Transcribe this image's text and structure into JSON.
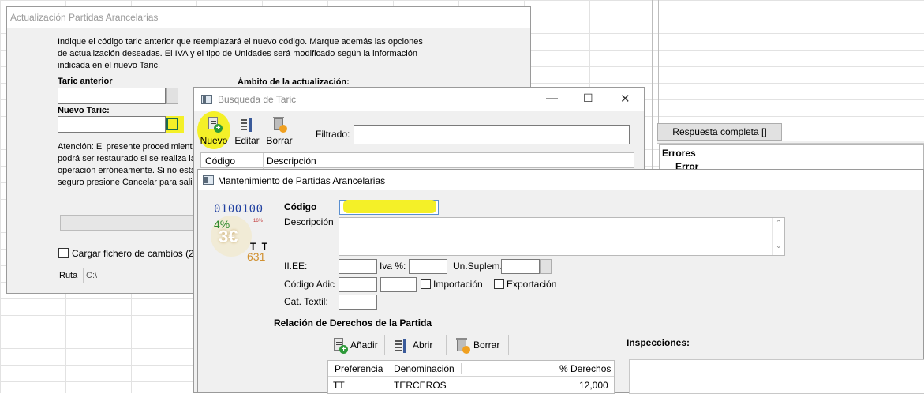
{
  "background": {
    "respuesta_button": "Respuesta completa []",
    "tree": {
      "node1": "Errores",
      "node2": "Error"
    }
  },
  "actualizacion": {
    "title": "Actualización Partidas Arancelarias",
    "description": "Indique el código taric anterior que reemplazará el nuevo código. Marque además las opciones de actualización deseadas. El IVA y el tipo de Unidades será modificado según la información indicada en el nuevo Taric.",
    "taric_anterior_label": "Taric anterior",
    "nuevo_taric_label": "Nuevo Taric:",
    "ambito_label": "Ámbito de la actualización:",
    "warning_lines": [
      "Atención: El presente procedimiento",
      "podrá ser restaurado si se realiza la",
      "operación erróneamente. Si no está",
      "seguro presione Cancelar para salir"
    ],
    "cargar_label": "Cargar fichero de cambios (2",
    "ruta_label": "Ruta",
    "ruta_value": "C:\\"
  },
  "busqueda": {
    "title": "Busqueda  de Taric",
    "controls": {
      "minimize": "—",
      "maximize": "☐",
      "close": "✕"
    },
    "toolbar": {
      "nuevo": "Nuevo",
      "editar": "Editar",
      "borrar": "Borrar"
    },
    "filtrado_label": "Filtrado:",
    "grid_headers": [
      "Código",
      "Descripción"
    ]
  },
  "mantenimiento": {
    "title": "Mantenimiento de Partidas Arancelarias",
    "logo": {
      "binary": "0100100",
      "percent": "4%",
      "euro": "3€",
      "tt": "T T",
      "number": "631",
      "small": "16%"
    },
    "fields": {
      "codigo": "Código",
      "descripcion": "Descripción",
      "iiee": "II.EE:",
      "iva": "Iva %:",
      "unsuplem": "Un.Suplem.",
      "codigo_adic": "Código Adic",
      "importacion": "Importación",
      "exportacion": "Exportación",
      "cat_textil": "Cat. Textil:"
    },
    "relacion_label": "Relación de Derechos de la Partida",
    "inspecciones_label": "Inspecciones:",
    "toolbar": {
      "anadir": "Añadir",
      "abrir": "Abrir",
      "borrar": "Borrar"
    },
    "derechos": {
      "headers": [
        "Preferencia",
        "Denominación",
        "% Derechos"
      ],
      "rows": [
        {
          "preferencia": "TT",
          "denominacion": "TERCEROS",
          "derechos": "12,000"
        }
      ]
    }
  }
}
